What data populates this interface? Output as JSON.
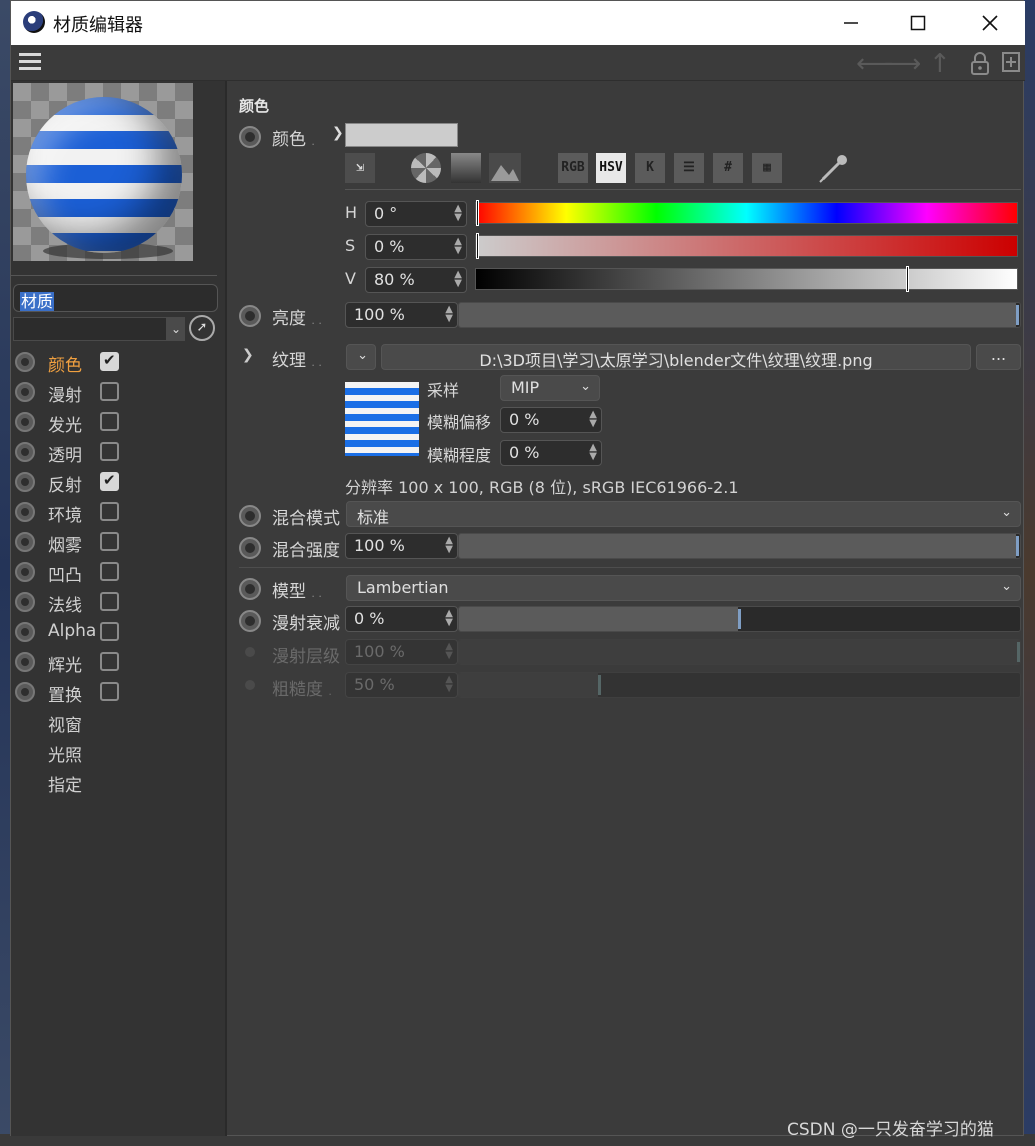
{
  "window": {
    "title": "材质编辑器"
  },
  "material_name": "材质",
  "channels": [
    {
      "label": "颜色",
      "checked": true,
      "active": true
    },
    {
      "label": "漫射",
      "checked": false
    },
    {
      "label": "发光",
      "checked": false
    },
    {
      "label": "透明",
      "checked": false
    },
    {
      "label": "反射",
      "checked": true
    },
    {
      "label": "环境",
      "checked": false
    },
    {
      "label": "烟雾",
      "checked": false
    },
    {
      "label": "凹凸",
      "checked": false
    },
    {
      "label": "法线",
      "checked": false
    },
    {
      "label": "Alpha",
      "checked": false
    },
    {
      "label": "辉光",
      "checked": false
    },
    {
      "label": "置换",
      "checked": false
    }
  ],
  "extra_sections": [
    "视窗",
    "光照",
    "指定"
  ],
  "color_section": {
    "title": "颜色",
    "color_label": "颜色",
    "tools": [
      "RGB",
      "HSV",
      "K",
      "#"
    ],
    "h_label": "H",
    "h_value": "0 °",
    "s_label": "S",
    "s_value": "0 %",
    "v_label": "V",
    "v_value": "80 %",
    "v_fraction": 0.8,
    "brightness_label": "亮度",
    "brightness_value": "100 %",
    "brightness_fraction": 1.0,
    "texture_label": "纹理",
    "texture_path": "D:\\3D项目\\学习\\太原学习\\blender文件\\纹理\\纹理.png",
    "texture_more": "...",
    "sampling_label": "采样",
    "sampling_value": "MIP",
    "blur_offset_label": "模糊偏移",
    "blur_offset_value": "0 %",
    "blur_scale_label": "模糊程度",
    "blur_scale_value": "0 %",
    "resolution_info": "分辨率 100 x 100, RGB (8 位), sRGB IEC61966-2.1",
    "mix_mode_label": "混合模式",
    "mix_mode_value": "标准",
    "mix_strength_label": "混合强度",
    "mix_strength_value": "100 %",
    "mix_strength_fraction": 1.0,
    "model_label": "模型",
    "model_value": "Lambertian",
    "diffuse_falloff_label": "漫射衰减",
    "diffuse_falloff_value": "0 %",
    "diffuse_falloff_fraction": 0.5,
    "diffuse_level_label": "漫射层级",
    "diffuse_level_value": "100 %",
    "roughness_label": "粗糙度",
    "roughness_value": "50 %",
    "roughness_fraction": 0.25
  },
  "colors": {
    "accent_active": "#f0a040",
    "selection": "#3a6fc8"
  },
  "watermark": "CSDN @一只发奋学习的猫"
}
